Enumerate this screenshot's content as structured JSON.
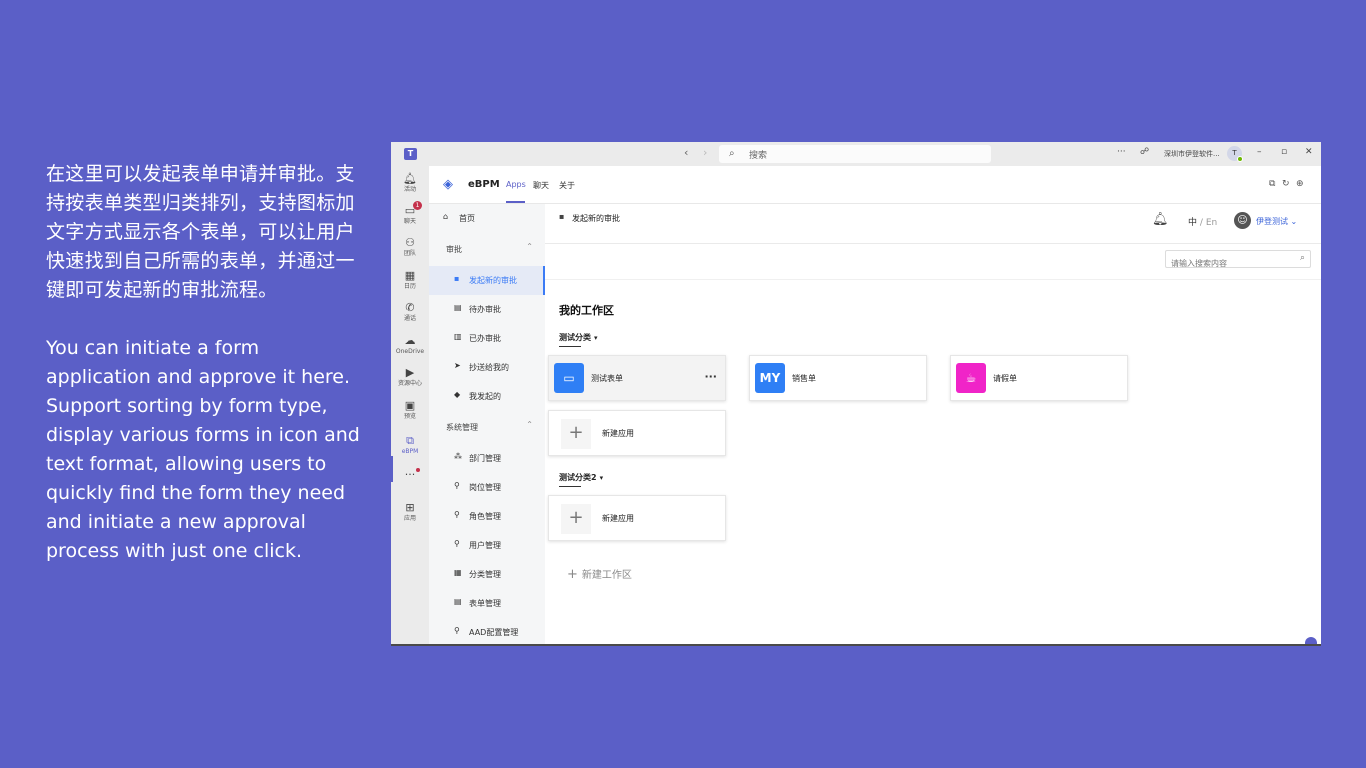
{
  "caption": {
    "zh": "在这里可以发起表单申请并审批。支持按表单类型归类排列，支持图标加文字方式显示各个表单，可以让用户快速找到自己所需的表单，并通过一键即可发起新的审批流程。",
    "en": "You can initiate a form application and approve it here. Support sorting by form type, display various forms in icon and text format, allowing users to quickly find the form they need and initiate a new approval process with just one click."
  },
  "titlebar": {
    "search_placeholder": "搜索",
    "org": "深圳市伊登软件...",
    "avatar_initial": "T"
  },
  "rail": {
    "items": [
      {
        "label": "活动",
        "icon": "bell-icon"
      },
      {
        "label": "聊天",
        "icon": "chat-icon",
        "badge": "1"
      },
      {
        "label": "团队",
        "icon": "teams-icon"
      },
      {
        "label": "日历",
        "icon": "calendar-icon"
      },
      {
        "label": "通话",
        "icon": "phone-icon"
      },
      {
        "label": "OneDrive",
        "icon": "cloud-icon"
      },
      {
        "label": "资源中心",
        "icon": "video-icon"
      },
      {
        "label": "预览",
        "icon": "bookmark-icon"
      },
      {
        "label": "eBPM",
        "icon": "ebpm-icon"
      },
      {
        "label": "",
        "icon": "more-icon"
      },
      {
        "label": "应用",
        "icon": "add-app-icon"
      }
    ]
  },
  "app": {
    "name": "eBPM",
    "tabs": [
      "Apps",
      "聊天",
      "关于"
    ],
    "accent": "#5b5fc7"
  },
  "sidebar": {
    "home": "首页",
    "approval_group": "审批",
    "approval_items": [
      "发起新的审批",
      "待办审批",
      "已办审批",
      "抄送给我的",
      "我发起的"
    ],
    "system_group": "系统管理",
    "system_items": [
      "部门管理",
      "岗位管理",
      "角色管理",
      "用户管理",
      "分类管理",
      "表单管理",
      "AAD配置管理"
    ]
  },
  "main": {
    "breadcrumb": "发起新的审批",
    "lang_zh": "中",
    "lang_sep": "/",
    "lang_en": "En",
    "user": "伊登测试",
    "search_placeholder": "请输入搜索内容",
    "workspace_title": "我的工作区",
    "categories": [
      {
        "name": "测试分类",
        "apps": [
          {
            "name": "测试表单",
            "tile_text": "",
            "color": "#2f7ff5"
          },
          {
            "name": "销售单",
            "tile_text": "MY",
            "color": "#2f7ff5"
          },
          {
            "name": "请假单",
            "tile_text": "",
            "color": "#f024c8"
          }
        ],
        "new_app": "新建应用"
      },
      {
        "name": "测试分类2",
        "apps": [],
        "new_app": "新建应用"
      }
    ],
    "new_workspace": "新建工作区"
  }
}
